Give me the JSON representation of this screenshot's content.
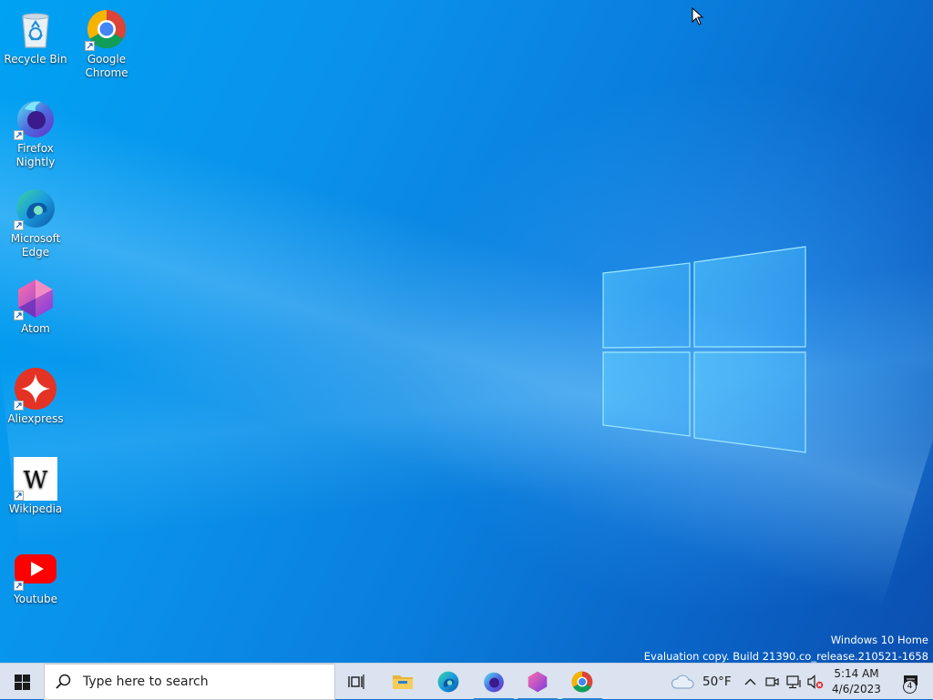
{
  "desktop": {
    "icons": [
      {
        "id": "recycle-bin",
        "label": "Recycle Bin",
        "icon": "recycle-bin-icon",
        "shortcut": false
      },
      {
        "id": "google-chrome",
        "label": "Google Chrome",
        "icon": "chrome-icon",
        "shortcut": true
      },
      {
        "id": "firefox-nightly",
        "label": "Firefox Nightly",
        "icon": "firefox-nightly-icon",
        "shortcut": true
      },
      {
        "id": "microsoft-edge",
        "label": "Microsoft Edge",
        "icon": "edge-icon",
        "shortcut": true
      },
      {
        "id": "atom",
        "label": "Atom",
        "icon": "atom-icon",
        "shortcut": true
      },
      {
        "id": "aliexpress",
        "label": "Aliexpress",
        "icon": "aliexpress-icon",
        "shortcut": true
      },
      {
        "id": "wikipedia",
        "label": "Wikipedia",
        "icon": "wikipedia-icon",
        "shortcut": true
      },
      {
        "id": "youtube",
        "label": "Youtube",
        "icon": "youtube-icon",
        "shortcut": true
      }
    ]
  },
  "watermark": {
    "line1": "Windows 10 Home",
    "line2": "Evaluation copy. Build 21390.co_release.210521-1658"
  },
  "taskbar": {
    "start": {
      "icon": "windows-start-icon"
    },
    "search": {
      "placeholder": "Type here to search",
      "icon": "search-icon"
    },
    "apps": [
      {
        "name": "task-view",
        "icon": "task-view-icon",
        "running": false
      },
      {
        "name": "file-explorer",
        "icon": "file-explorer-icon",
        "running": false
      },
      {
        "name": "microsoft-edge",
        "icon": "edge-icon",
        "running": false
      },
      {
        "name": "firefox-nightly",
        "icon": "firefox-nightly-icon",
        "running": true
      },
      {
        "name": "atom",
        "icon": "atom-icon",
        "running": true
      },
      {
        "name": "google-chrome",
        "icon": "chrome-icon",
        "running": true
      }
    ],
    "tray": {
      "weather": {
        "icon": "cloud-icon",
        "text": "50°F"
      },
      "icons": [
        "chevron-up-icon",
        "meet-now-icon",
        "network-icon",
        "volume-muted-icon"
      ],
      "clock": {
        "time": "5:14 AM",
        "date": "4/6/2023"
      },
      "notifications": {
        "icon": "action-center-icon",
        "count": "4"
      }
    }
  },
  "colors": {
    "taskbar_bg": "#dae3ef",
    "wallpaper_primary": "#0a7fdd",
    "running_indicator": "#2a7fd4"
  }
}
